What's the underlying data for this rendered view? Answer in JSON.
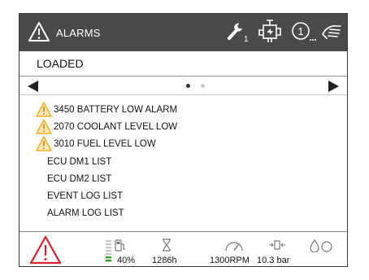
{
  "header": {
    "title": "ALARMS",
    "service_badge": "1",
    "colors": {
      "bar": "#4a4a4a",
      "text": "#ffffff"
    },
    "icons": [
      "warning-icon",
      "wrench-icon",
      "engine-icon",
      "counter-icon",
      "hand-icon"
    ]
  },
  "status": "LOADED",
  "pager": {
    "pages": 2,
    "current": 1
  },
  "items": [
    {
      "label": "3450 BATTERY LOW ALARM",
      "warning": true
    },
    {
      "label": "2070 COOLANT LEVEL LOW",
      "warning": true
    },
    {
      "label": "3010 FUEL LEVEL LOW",
      "warning": true
    },
    {
      "label": "ECU DM1 LIST",
      "warning": false
    },
    {
      "label": "ECU DM2 LIST",
      "warning": false
    },
    {
      "label": "EVENT LOG LIST",
      "warning": false
    },
    {
      "label": "ALARM LOG LIST",
      "warning": false
    }
  ],
  "footer": {
    "fuel": "40%",
    "hours": "1286h",
    "speed": "1300RPM",
    "pressure": "10.3 bar",
    "fuel_level_fraction": 0.4,
    "colors": {
      "alarm": "#d8202a",
      "fuel": "#2ca02c",
      "warning_fill": "#f7a600"
    }
  }
}
